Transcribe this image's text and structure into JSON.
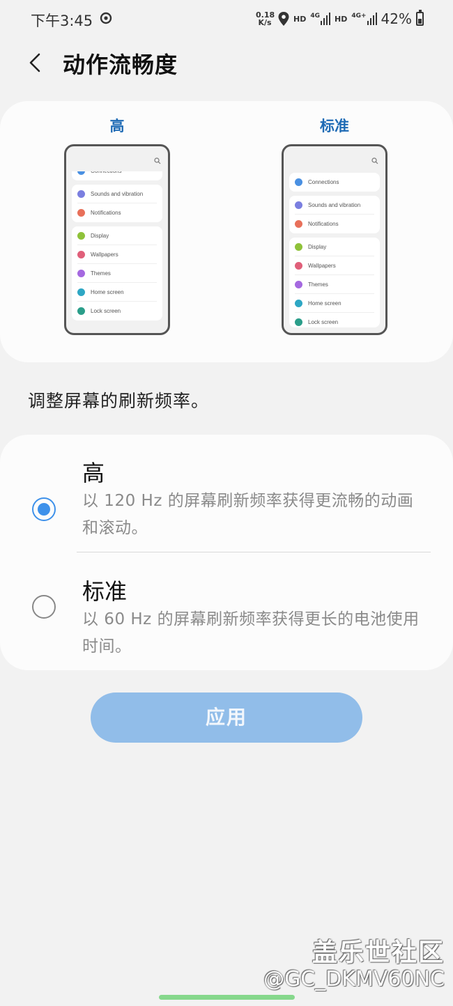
{
  "status_bar": {
    "time": "下午3:45",
    "net_speed_value": "0.18",
    "net_speed_unit": "K/s",
    "hd1": "HD",
    "sig1_label": "4G",
    "hd2": "HD",
    "sig2_label": "4G+",
    "battery": "42%"
  },
  "header": {
    "title": "动作流畅度"
  },
  "preview": {
    "high_label": "高",
    "standard_label": "标准",
    "items": [
      {
        "group": 1,
        "label": "Connections",
        "color": "#4a90e2"
      },
      {
        "group": 2,
        "label": "Sounds and vibration",
        "color": "#7b7fe0"
      },
      {
        "group": 2,
        "label": "Notifications",
        "color": "#e8705a"
      },
      {
        "group": 3,
        "label": "Display",
        "color": "#8fc23a"
      },
      {
        "group": 3,
        "label": "Wallpapers",
        "color": "#e0607a"
      },
      {
        "group": 3,
        "label": "Themes",
        "color": "#a569e0"
      },
      {
        "group": 3,
        "label": "Home screen",
        "color": "#2ea7c4"
      },
      {
        "group": 3,
        "label": "Lock screen",
        "color": "#2b9e8a"
      }
    ]
  },
  "description": "调整屏幕的刷新频率。",
  "options": {
    "high": {
      "title": "高",
      "desc": "以 120 Hz 的屏幕刷新频率获得更流畅的动画和滚动。",
      "selected": true
    },
    "standard": {
      "title": "标准",
      "desc": "以 60 Hz 的屏幕刷新频率获得更长的电池使用时间。",
      "selected": false
    }
  },
  "apply_label": "应用",
  "watermark": {
    "site": "盖乐世社区",
    "user": "@GC_DKMV60NC"
  },
  "accent_color": "#3e91ea"
}
